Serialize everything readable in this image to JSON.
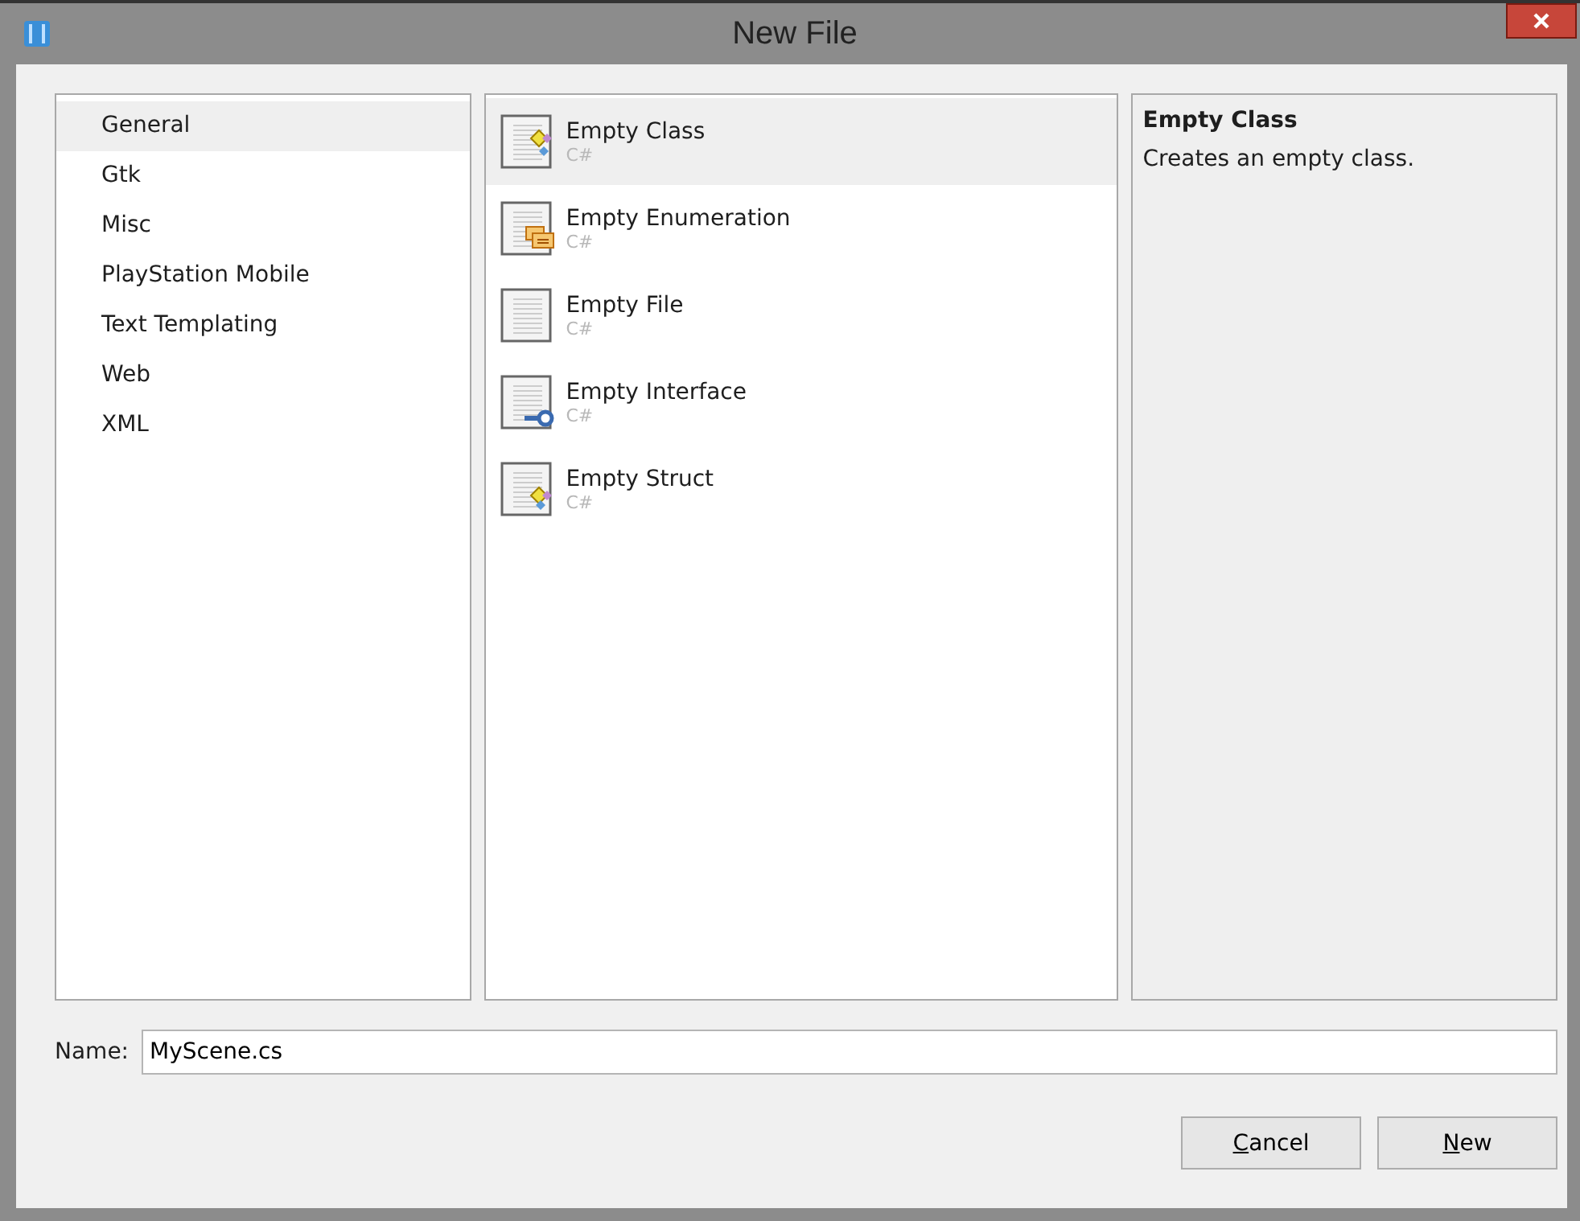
{
  "window": {
    "title": "New File"
  },
  "categories": [
    {
      "label": "General",
      "selected": true
    },
    {
      "label": "Gtk",
      "selected": false
    },
    {
      "label": "Misc",
      "selected": false
    },
    {
      "label": "PlayStation Mobile",
      "selected": false
    },
    {
      "label": "Text Templating",
      "selected": false
    },
    {
      "label": "Web",
      "selected": false
    },
    {
      "label": "XML",
      "selected": false
    }
  ],
  "templates": [
    {
      "name": "Empty Class",
      "language": "C#",
      "kind": "class",
      "selected": true
    },
    {
      "name": "Empty Enumeration",
      "language": "C#",
      "kind": "enumeration",
      "selected": false
    },
    {
      "name": "Empty File",
      "language": "C#",
      "kind": "file",
      "selected": false
    },
    {
      "name": "Empty Interface",
      "language": "C#",
      "kind": "interface",
      "selected": false
    },
    {
      "name": "Empty Struct",
      "language": "C#",
      "kind": "struct",
      "selected": false
    }
  ],
  "description": {
    "title": "Empty Class",
    "text": "Creates an empty class."
  },
  "name_field": {
    "label": "Name:",
    "value": "MyScene.cs"
  },
  "buttons": [
    "Cancel",
    "New"
  ]
}
